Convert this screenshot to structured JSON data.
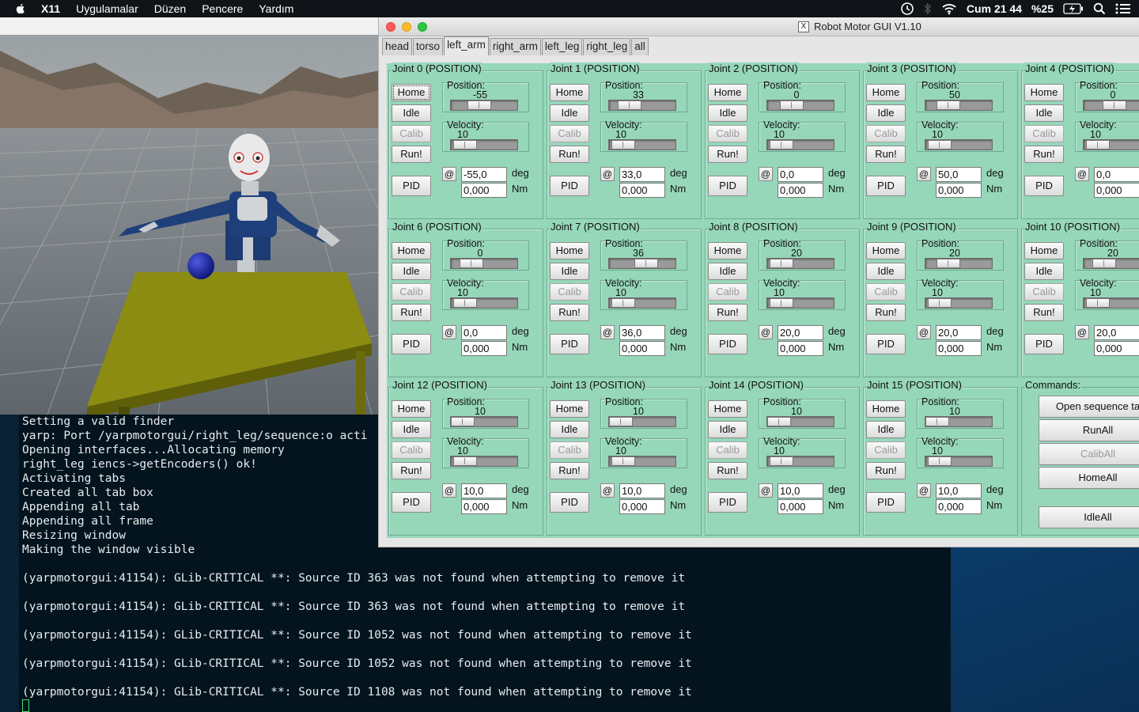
{
  "menubar": {
    "app_name": "X11",
    "items": [
      "Uygulamalar",
      "Düzen",
      "Pencere",
      "Yardım"
    ],
    "clock": "Cum 21 44",
    "battery": "%25"
  },
  "window": {
    "title": "Robot Motor GUI V1.10",
    "x11_icon": "X",
    "tabs": [
      "head",
      "torso",
      "left_arm",
      "right_arm",
      "left_leg",
      "right_leg",
      "all"
    ],
    "active_tab": "left_arm"
  },
  "labels": {
    "home": "Home",
    "idle": "Idle",
    "calib": "Calib",
    "run": "Run!",
    "pid": "PID",
    "position": "Position:",
    "velocity": "Velocity:",
    "at": "@",
    "deg": "deg",
    "nm": "Nm"
  },
  "joints": [
    {
      "title": "Joint 0  (POSITION)",
      "position": "-55",
      "velocity": "10",
      "pos_entry": "-55,0",
      "torque_entry": "0,000",
      "slider_pos": 0.38,
      "slider_vel": 0.05
    },
    {
      "title": "Joint 1  (POSITION)",
      "position": "33",
      "velocity": "10",
      "pos_entry": "33,0",
      "torque_entry": "0,000",
      "slider_pos": 0.2,
      "slider_vel": 0.05
    },
    {
      "title": "Joint 2  (POSITION)",
      "position": "0",
      "velocity": "10",
      "pos_entry": "0,0",
      "torque_entry": "0,000",
      "slider_pos": 0.3,
      "slider_vel": 0.05
    },
    {
      "title": "Joint 3  (POSITION)",
      "position": "50",
      "velocity": "10",
      "pos_entry": "50,0",
      "torque_entry": "0,000",
      "slider_pos": 0.25,
      "slider_vel": 0.05
    },
    {
      "title": "Joint 4  (POSITION)",
      "position": "0",
      "velocity": "10",
      "pos_entry": "0,0",
      "torque_entry": "0,000",
      "slider_pos": 0.45,
      "slider_vel": 0.05
    },
    {
      "title": "Joint 6  (POSITION)",
      "position": "0",
      "velocity": "10",
      "pos_entry": "0,0",
      "torque_entry": "0,000",
      "slider_pos": 0.2,
      "slider_vel": 0.05
    },
    {
      "title": "Joint 7  (POSITION)",
      "position": "36",
      "velocity": "10",
      "pos_entry": "36,0",
      "torque_entry": "0,000",
      "slider_pos": 0.6,
      "slider_vel": 0.05
    },
    {
      "title": "Joint 8  (POSITION)",
      "position": "20",
      "velocity": "10",
      "pos_entry": "20,0",
      "torque_entry": "0,000",
      "slider_pos": 0.05,
      "slider_vel": 0.05
    },
    {
      "title": "Joint 9  (POSITION)",
      "position": "20",
      "velocity": "10",
      "pos_entry": "20,0",
      "torque_entry": "0,000",
      "slider_pos": 0.25,
      "slider_vel": 0.05
    },
    {
      "title": "Joint 10  (POSITION)",
      "position": "20",
      "velocity": "10",
      "pos_entry": "20,0",
      "torque_entry": "0,000",
      "slider_pos": 0.2,
      "slider_vel": 0.05
    },
    {
      "title": "Joint 12  (POSITION)",
      "position": "10",
      "velocity": "10",
      "pos_entry": "10,0",
      "torque_entry": "0,000",
      "slider_pos": 0.0,
      "slider_vel": 0.05
    },
    {
      "title": "Joint 13  (POSITION)",
      "position": "10",
      "velocity": "10",
      "pos_entry": "10,0",
      "torque_entry": "0,000",
      "slider_pos": 0.0,
      "slider_vel": 0.05
    },
    {
      "title": "Joint 14  (POSITION)",
      "position": "10",
      "velocity": "10",
      "pos_entry": "10,0",
      "torque_entry": "0,000",
      "slider_pos": 0.0,
      "slider_vel": 0.05
    },
    {
      "title": "Joint 15  (POSITION)",
      "position": "10",
      "velocity": "10",
      "pos_entry": "10,0",
      "torque_entry": "0,000",
      "slider_pos": 0.0,
      "slider_vel": 0.05
    }
  ],
  "commands": {
    "title": "Commands:",
    "open_sequence": "Open sequence ta",
    "run_all": "RunAll",
    "calib_all": "CalibAll",
    "home_all": "HomeAll",
    "idle_all": "IdleAll"
  },
  "terminal": {
    "lines": [
      "Setting a valid finder",
      "yarp: Port /yarpmotorgui/right_leg/sequence:o acti",
      "Opening interfaces...Allocating memory",
      "right_leg iencs->getEncoders() ok!",
      "Activating tabs",
      "Created all tab box",
      "Appending all tab",
      "Appending all frame",
      "Resizing window",
      "Making the window visible",
      "",
      "(yarpmotorgui:41154): GLib-CRITICAL **: Source ID 363 was not found when attempting to remove it",
      "",
      "(yarpmotorgui:41154): GLib-CRITICAL **: Source ID 363 was not found when attempting to remove it",
      "",
      "(yarpmotorgui:41154): GLib-CRITICAL **: Source ID 1052 was not found when attempting to remove it",
      "",
      "(yarpmotorgui:41154): GLib-CRITICAL **: Source ID 1052 was not found when attempting to remove it",
      "",
      "(yarpmotorgui:41154): GLib-CRITICAL **: Source ID 1108 was not found when attempting to remove it"
    ]
  },
  "colors": {
    "panel": "#96d7b9",
    "terminal_bg": "#03141f",
    "table": "#8c8c12",
    "ball": "#1c2aa0"
  }
}
